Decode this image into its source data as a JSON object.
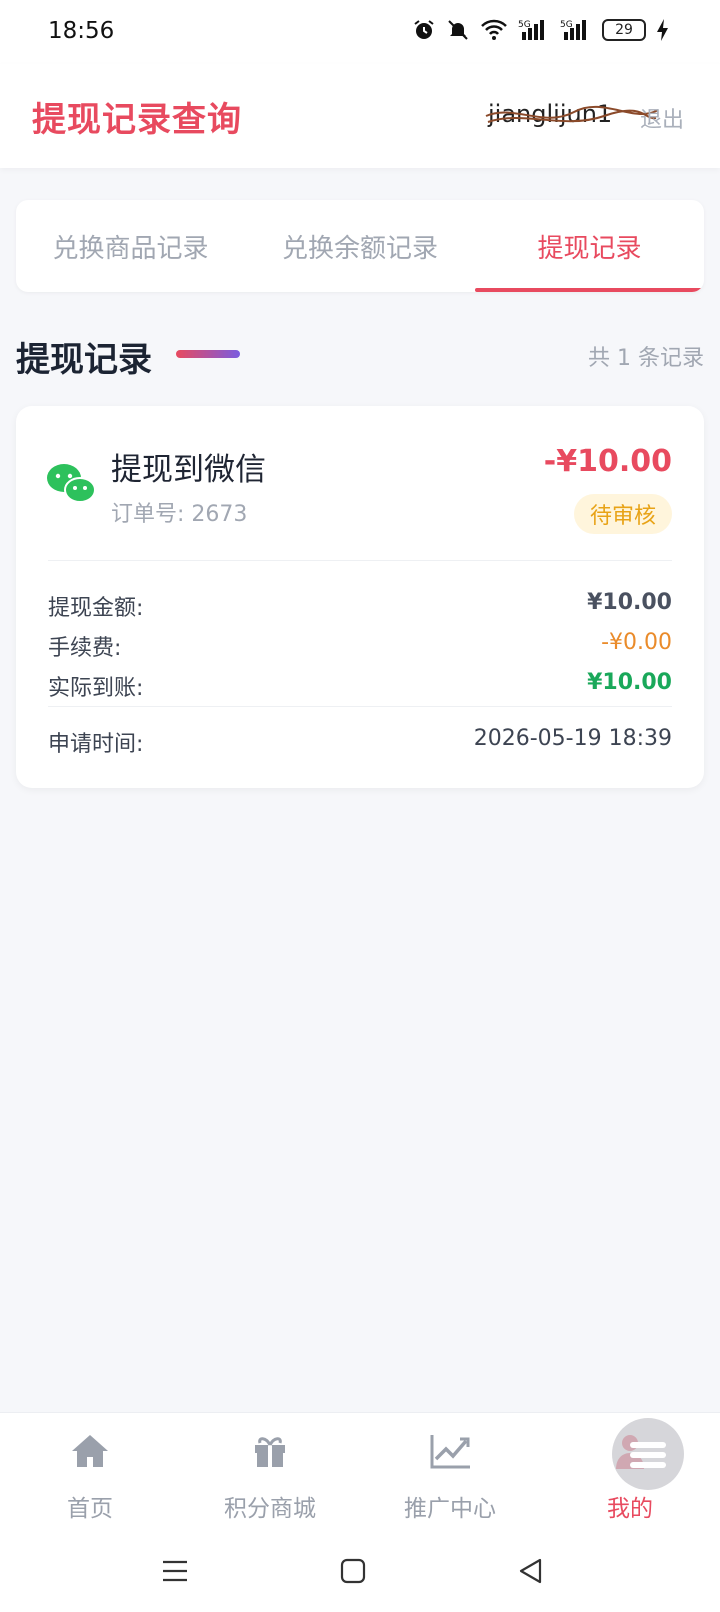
{
  "status_bar": {
    "time": "18:56",
    "battery": "29"
  },
  "header": {
    "title": "提现记录查询",
    "username": "jianglijun1",
    "logout_label": "退出"
  },
  "tabs": [
    {
      "label": "兑换商品记录",
      "active": false
    },
    {
      "label": "兑换余额记录",
      "active": false
    },
    {
      "label": "提现记录",
      "active": true
    }
  ],
  "section": {
    "title": "提现记录",
    "count_text": "共 1 条记录"
  },
  "record": {
    "method": "提现到微信",
    "order_label": "订单号:",
    "order_no": "2673",
    "amount": "-¥10.00",
    "status": "待审核",
    "rows": [
      {
        "label": "提现金额:",
        "value": "¥10.00"
      },
      {
        "label": "手续费:",
        "value": "-¥0.00"
      },
      {
        "label": "实际到账:",
        "value": "¥10.00"
      }
    ],
    "time_label": "申请时间:",
    "time_value": "2026-05-19 18:39"
  },
  "bottom_nav": [
    {
      "label": "首页",
      "icon": "home-icon"
    },
    {
      "label": "积分商城",
      "icon": "gift-icon"
    },
    {
      "label": "推广中心",
      "icon": "chart-icon"
    },
    {
      "label": "我的",
      "icon": "user-icon",
      "active": true
    }
  ],
  "colors": {
    "accent": "#e84a5f",
    "pending": "#e8a317",
    "fee": "#ea8b2a",
    "received": "#1aa85a",
    "wechat": "#2dc15c"
  }
}
